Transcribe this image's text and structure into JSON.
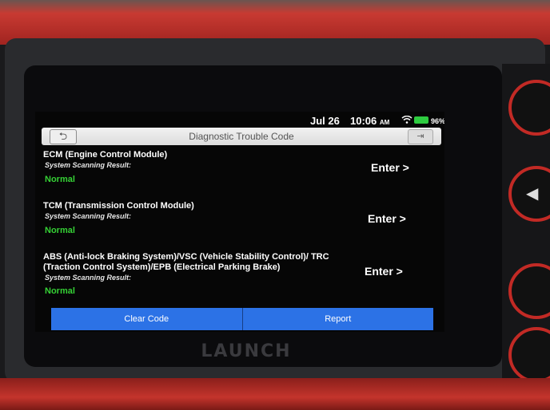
{
  "device": {
    "brand": "LAUNCH"
  },
  "status_bar": {
    "date": "Jul 26",
    "time": "10:06",
    "ampm": "AM",
    "battery": "96%"
  },
  "header": {
    "title": "Diagnostic Trouble Code"
  },
  "modules": [
    {
      "name": "ECM (Engine Control Module)",
      "scan_label": "System Scanning Result:",
      "result": "Normal",
      "action": "Enter >"
    },
    {
      "name": "TCM (Transmission Control Module)",
      "scan_label": "System Scanning Result:",
      "result": "Normal",
      "action": "Enter >"
    },
    {
      "name": "ABS (Anti-lock Braking System)/VSC (Vehicle Stability Control)/ TRC (Traction Control System)/EPB (Electrical Parking Brake)",
      "scan_label": "System Scanning Result:",
      "result": "Normal",
      "action": "Enter >"
    }
  ],
  "footer": {
    "clear_code": "Clear Code",
    "report": "Report"
  },
  "icons": {
    "back": "back-icon",
    "exit": "exit-icon",
    "wifi": "wifi-icon",
    "battery": "battery-icon"
  },
  "colors": {
    "accent": "#2c72e6",
    "normal": "#35d135"
  }
}
